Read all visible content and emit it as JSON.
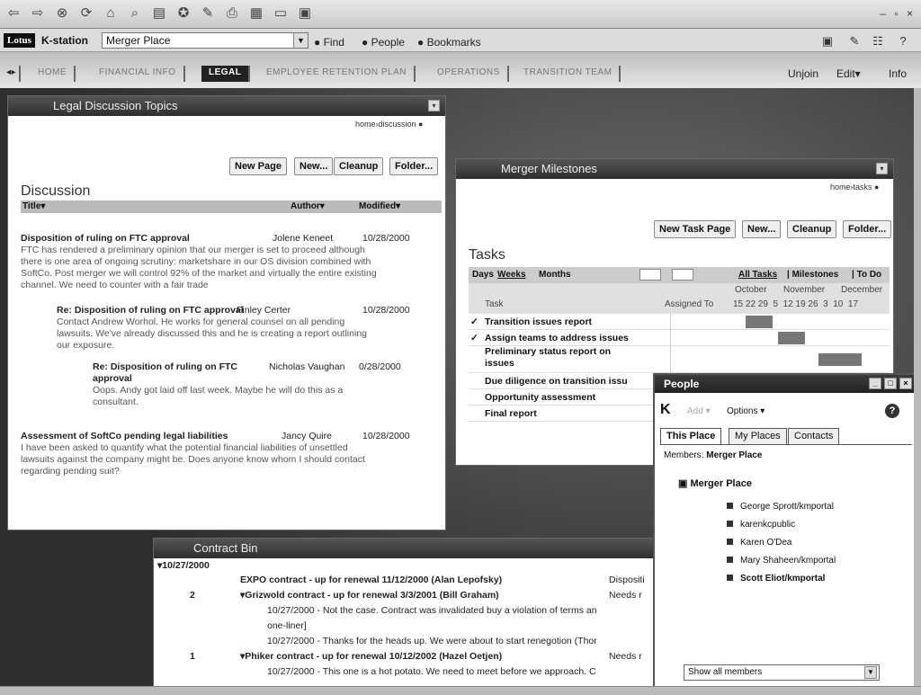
{
  "toolbar": {
    "icons": [
      "back-icon",
      "forward-icon",
      "stop-icon",
      "refresh-icon",
      "home-icon",
      "search-icon",
      "folder-icon",
      "favorites-icon",
      "edit-icon",
      "print-icon",
      "view-icon",
      "window-icon",
      "calendar-icon"
    ]
  },
  "locbar": {
    "brand": "Lotus",
    "app": "K-station",
    "place": "Merger Place",
    "links": [
      "Find",
      "People",
      "Bookmarks"
    ]
  },
  "tabs": [
    "HOME",
    "FINANCIAL INFO",
    "LEGAL",
    "EMPLOYEE RETENTION PLAN",
    "OPERATIONS",
    "TRANSITION TEAM"
  ],
  "tabs_right": {
    "unjoin": "Unjoin",
    "edit": "Edit▾",
    "info": "Info"
  },
  "legal": {
    "title": "Legal Discussion Topics",
    "crumb": "home›discussion ●",
    "buttons": [
      "New Page",
      "New...",
      "Cleanup",
      "Folder..."
    ],
    "heading": "Discussion",
    "cols": {
      "title": "Title▾",
      "author": "Author▾",
      "modified": "Modified▾"
    },
    "posts": [
      {
        "title": "Disposition of ruling on FTC approval",
        "author": "Jolene Keneet",
        "date": "10/28/2000",
        "body": [
          "FTC has rendered a preliminary opinion that our merger is set to proceed although",
          "there is one area of ongoing scrutiny: marketshare in our OS division combined with",
          "SoftCo. Post merger we will control 92% of the market and virtually the entire existing",
          "channel. We need to counter with a fair trade"
        ]
      },
      {
        "title": "Re: Disposition of ruling on FTC approval",
        "author": "Finley Certer",
        "date": "10/28/2000",
        "body": [
          "Contact Andrew Worhol. He works for general counsel on all pending",
          "lawsuits. We've already discussed this and he is creating a report outlining",
          "our exposure."
        ]
      },
      {
        "title": "Re: Disposition of ruling on FTC",
        "title2": "approval",
        "author": "Nicholas Vaughan",
        "date": "0/28/2000",
        "body": [
          "Oops. Andy got laid off last week. Maybe he will do this as a",
          "consultant."
        ]
      },
      {
        "title": "Assessment of SoftCo pending legal liabilities",
        "author": "Jancy Quire",
        "date": "10/28/2000",
        "body": [
          "I have been asked to quantify what the potential financial liabilities of unsettled",
          "lawsuits against the company might be. Does anyone know whom I should contact",
          "regarding pending suit?"
        ]
      }
    ]
  },
  "milestones": {
    "title": "Merger Milestones",
    "crumb": "home›tasks ●",
    "buttons": [
      "New Task Page",
      "New...",
      "Cleanup",
      "Folder..."
    ],
    "heading": "Tasks",
    "views": {
      "days": "Days",
      "weeks": "Weeks",
      "months": "Months"
    },
    "filters": {
      "all": "All Tasks",
      "milestones": "| Milestones",
      "todo": "| To Do"
    },
    "months": [
      "October",
      "November",
      "December"
    ],
    "weeks": "15 22 29  5  12 19 26  3  10  17",
    "colTask": "Task",
    "colAssigned": "Assigned To",
    "tasks": [
      {
        "check": "✓",
        "name": "Transition issues report",
        "bar": 0.1
      },
      {
        "check": "✓",
        "name": "Assign teams to address issues",
        "bar": 0.3
      },
      {
        "check": "",
        "name": "Preliminary status report on",
        "name2": "issues",
        "bar": 0.55
      },
      {
        "check": "",
        "name": "Due diligence on transition issu",
        "bar": null
      },
      {
        "check": "",
        "name": "Opportunity assessment",
        "bar": null
      },
      {
        "check": "",
        "name": "Final report",
        "bar": null
      }
    ]
  },
  "contract": {
    "title": "Contract Bin",
    "group": "▾10/27/2000",
    "rows": [
      {
        "num": "",
        "text": "EXPO contract - up for renewal 11/12/2000  (Alan Lepofsky)",
        "status": "Dispositi"
      },
      {
        "num": "2",
        "text": "▾Grizwold contract - up for renewal 3/3/2001  (Bill Graham)",
        "status": "Needs r"
      },
      {
        "num": "",
        "text": "10/27/2000 - Not the case. Contract was invalidated buy a violation of terms an",
        "status": "",
        "plain": true
      },
      {
        "num": "",
        "text": "one-liner]",
        "status": "",
        "plain": true
      },
      {
        "num": "",
        "text": "10/27/2000 - Thanks for the heads up. We were about to start renegotion (Thor",
        "status": "",
        "plain": true
      },
      {
        "num": "1",
        "text": "▾Phiker contract - up for renewal 10/12/2002  (Hazel Oetjen)",
        "status": "Needs r"
      },
      {
        "num": "",
        "text": "10/27/2000 - This one is a hot potato. We need to meet before we approach. C",
        "status": "",
        "plain": true
      }
    ]
  },
  "people": {
    "title": "People",
    "add": "Add ▾",
    "options": "Options ▾",
    "tabs": [
      "This Place",
      "My Places",
      "Contacts"
    ],
    "membersLabel": "Members:",
    "membersPlace": "Merger Place",
    "group": "Merger Place",
    "members": [
      {
        "name": "George Sprott/kmportal",
        "bold": false
      },
      {
        "name": "karenkcpublic",
        "bold": false
      },
      {
        "name": "Karen O'Dea",
        "bold": false
      },
      {
        "name": "Mary Shaheen/kmportal",
        "bold": false
      },
      {
        "name": "Scott Eliot/kmportal",
        "bold": true
      }
    ],
    "filter": "Show all members"
  }
}
